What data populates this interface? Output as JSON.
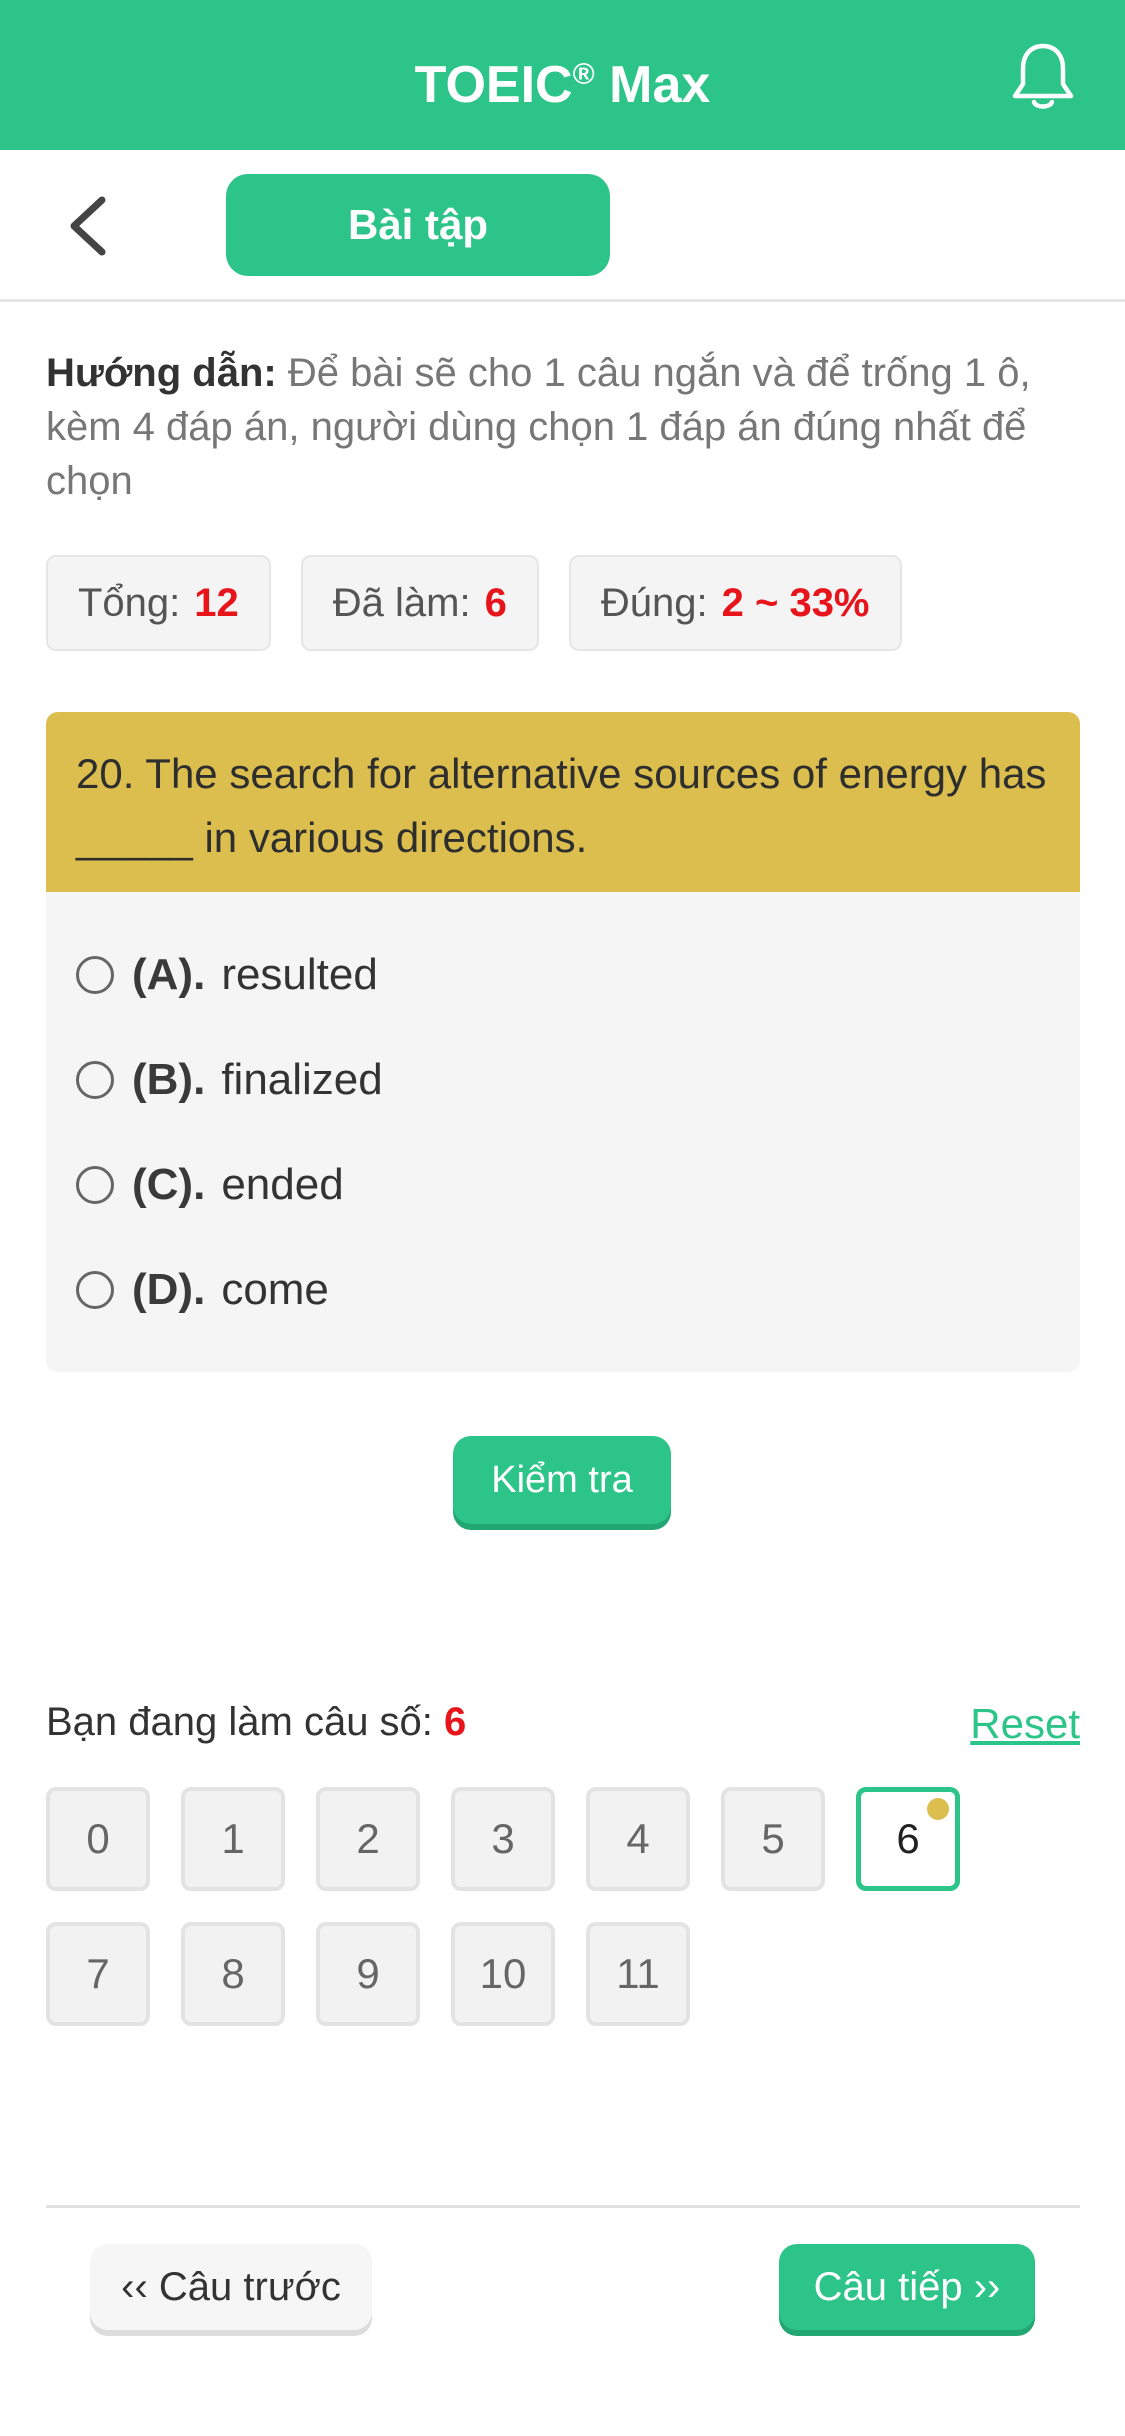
{
  "header": {
    "title": "TOEIC",
    "title_sup": "®",
    "title_suffix": " Max",
    "bell_icon": "bell-icon"
  },
  "subbar": {
    "back_icon": "chevron-left-icon",
    "tab_label": "Bài tập"
  },
  "guide": {
    "label": "Hướng dẫn:",
    "text": " Để bài sẽ cho 1 câu ngắn và để trống 1 ô, kèm 4 đáp án, người dùng chọn 1 đáp án đúng nhất để chọn"
  },
  "stats": {
    "total_label": "Tổng:",
    "total_value": "12",
    "done_label": "Đã làm:",
    "done_value": "6",
    "correct_label": "Đúng:",
    "correct_value": "2 ~ 33%"
  },
  "question": {
    "text": "20. The search for alternative sources of energy has _____ in various directions.",
    "options": [
      {
        "label": "(A).",
        "text": "resulted"
      },
      {
        "label": "(B).",
        "text": "finalized"
      },
      {
        "label": "(C).",
        "text": "ended"
      },
      {
        "label": "(D).",
        "text": "come"
      }
    ]
  },
  "check_button": "Kiểm tra",
  "progress": {
    "current_label": "Bạn đang làm câu số:",
    "current_value": "6",
    "reset_label": "Reset",
    "numbers": [
      "0",
      "1",
      "2",
      "3",
      "4",
      "5",
      "6",
      "7",
      "8",
      "9",
      "10",
      "11"
    ]
  },
  "nav": {
    "prev_label": "‹‹ Câu trước",
    "next_label": "Câu tiếp ››"
  },
  "colors": {
    "brand": "#2dc489",
    "question_bg": "#dbbe4d",
    "highlight": "#e8141c"
  }
}
